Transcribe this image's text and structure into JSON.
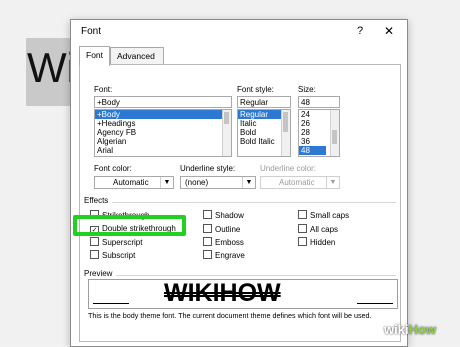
{
  "background": {
    "doc_text": "Wi"
  },
  "dialog": {
    "title": "Font",
    "help": "?",
    "close": "✕",
    "tabs": [
      {
        "label": "Font"
      },
      {
        "label": "Advanced"
      }
    ],
    "font": {
      "label": "Font:",
      "value": "+Body",
      "items": [
        "+Body",
        "+Headings",
        "Agency FB",
        "Algerian",
        "Arial"
      ],
      "selected": "+Body"
    },
    "font_style": {
      "label": "Font style:",
      "value": "Regular",
      "items": [
        "Regular",
        "Italic",
        "Bold",
        "Bold Italic"
      ],
      "selected": "Regular"
    },
    "size": {
      "label": "Size:",
      "value": "48",
      "items": [
        "24",
        "26",
        "28",
        "36",
        "48"
      ],
      "selected": "48"
    },
    "font_color": {
      "label": "Font color:",
      "value": "Automatic"
    },
    "underline_style": {
      "label": "Underline style:",
      "value": "(none)"
    },
    "underline_color": {
      "label": "Underline color:",
      "value": "Automatic"
    },
    "effects": {
      "label": "Effects",
      "strikethrough": "Strikethrough",
      "double_strikethrough": "Double strikethrough",
      "superscript": "Superscript",
      "subscript": "Subscript",
      "shadow": "Shadow",
      "outline": "Outline",
      "emboss": "Emboss",
      "engrave": "Engrave",
      "small_caps": "Small caps",
      "all_caps": "All caps",
      "hidden": "Hidden",
      "checked": [
        "Double strikethrough"
      ]
    },
    "preview": {
      "label": "Preview",
      "text": "WIKIHOW",
      "description": "This is the body theme font. The current document theme defines which font will be used."
    }
  },
  "watermark": {
    "wiki": "wiki",
    "how": "How"
  },
  "colors": {
    "highlight": "#1fd21f",
    "selection": "#2d78d3"
  }
}
